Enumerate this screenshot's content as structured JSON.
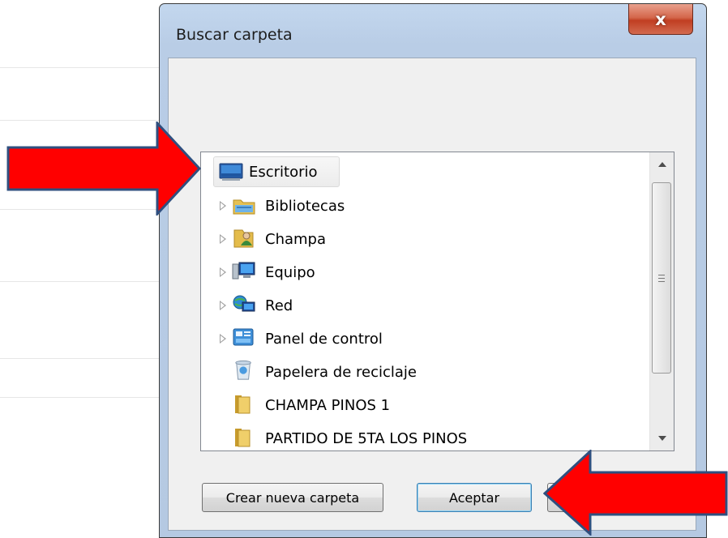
{
  "dialog": {
    "title": "Buscar carpeta",
    "close_label": "x"
  },
  "tree": {
    "items": [
      {
        "label": "Escritorio",
        "icon": "desktop-icon",
        "expandable": false,
        "selected": true
      },
      {
        "label": "Bibliotecas",
        "icon": "libraries-icon",
        "expandable": true
      },
      {
        "label": "Champa",
        "icon": "user-folder-icon",
        "expandable": true
      },
      {
        "label": "Equipo",
        "icon": "computer-icon",
        "expandable": true
      },
      {
        "label": "Red",
        "icon": "network-icon",
        "expandable": true
      },
      {
        "label": "Panel de control",
        "icon": "control-panel-icon",
        "expandable": true
      },
      {
        "label": "Papelera de reciclaje",
        "icon": "recycle-bin-icon",
        "expandable": false
      },
      {
        "label": "CHAMPA PINOS 1",
        "icon": "folder-icon",
        "expandable": false
      },
      {
        "label": "PARTIDO DE 5TA LOS PINOS",
        "icon": "folder-icon",
        "expandable": false
      }
    ]
  },
  "buttons": {
    "new_folder": "Crear nueva carpeta",
    "accept": "Aceptar"
  },
  "colors": {
    "arrow_red": "#ff0000",
    "arrow_outline": "#2f4f7f",
    "close_red": "#c94a2e",
    "dialog_frame": "#b9cde6"
  }
}
